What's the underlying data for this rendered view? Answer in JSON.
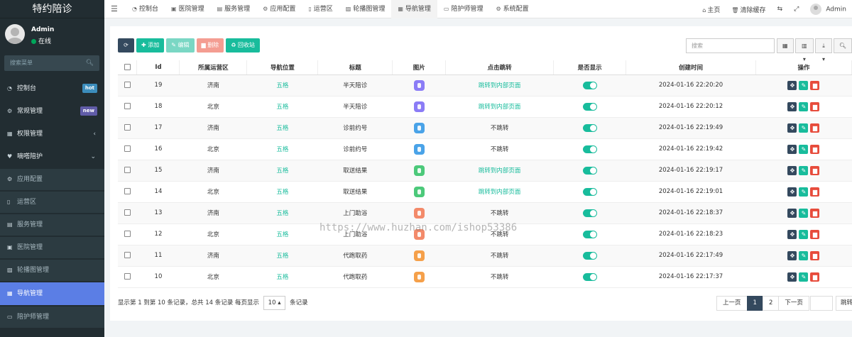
{
  "sidebar": {
    "brand": "特约陪诊",
    "user": {
      "name": "Admin",
      "status": "在线"
    },
    "search_placeholder": "搜索菜单",
    "items": [
      {
        "label": "控制台",
        "badge": "hot"
      },
      {
        "label": "常规管理",
        "badge": "new"
      },
      {
        "label": "权限管理",
        "caret": "‹"
      },
      {
        "label": "嘀嗒陪护",
        "caret": "⌄"
      },
      {
        "label": "应用配置"
      },
      {
        "label": "运营区"
      },
      {
        "label": "服务管理"
      },
      {
        "label": "医院管理"
      },
      {
        "label": "轮播图管理"
      },
      {
        "label": "导航管理"
      },
      {
        "label": "陪护师管理"
      }
    ]
  },
  "topbar": {
    "tabs": [
      "控制台",
      "医院管理",
      "服务管理",
      "应用配置",
      "运营区",
      "轮播图管理",
      "导航管理",
      "陪护师管理",
      "系统配置"
    ],
    "home": "主页",
    "clear_cache": "清除缓存",
    "user": "Admin"
  },
  "toolbar": {
    "add": "添加",
    "edit": "编辑",
    "delete": "删除",
    "recycle": "回收站",
    "search_placeholder": "搜索"
  },
  "table": {
    "headers": [
      "Id",
      "所属运营区",
      "导航位置",
      "标题",
      "图片",
      "点击跳转",
      "是否显示",
      "创建时间",
      "操作"
    ],
    "rows": [
      {
        "id": "19",
        "area": "济南",
        "pos": "五格",
        "title": "半天陪诊",
        "jump": "跳转到内部页面",
        "time": "2024-01-16 22:20:20",
        "color": "#8b7cf6"
      },
      {
        "id": "18",
        "area": "北京",
        "pos": "五格",
        "title": "半天陪诊",
        "jump": "跳转到内部页面",
        "time": "2024-01-16 22:20:12",
        "color": "#8b7cf6"
      },
      {
        "id": "17",
        "area": "济南",
        "pos": "五格",
        "title": "诊前约号",
        "jump": "不跳转",
        "time": "2024-01-16 22:19:49",
        "color": "#4aa3e8"
      },
      {
        "id": "16",
        "area": "北京",
        "pos": "五格",
        "title": "诊前约号",
        "jump": "不跳转",
        "time": "2024-01-16 22:19:42",
        "color": "#4aa3e8"
      },
      {
        "id": "15",
        "area": "济南",
        "pos": "五格",
        "title": "取送结果",
        "jump": "跳转到内部页面",
        "time": "2024-01-16 22:19:17",
        "color": "#4cc97a"
      },
      {
        "id": "14",
        "area": "北京",
        "pos": "五格",
        "title": "取送结果",
        "jump": "跳转到内部页面",
        "time": "2024-01-16 22:19:01",
        "color": "#4cc97a"
      },
      {
        "id": "13",
        "area": "济南",
        "pos": "五格",
        "title": "上门助浴",
        "jump": "不跳转",
        "time": "2024-01-16 22:18:37",
        "color": "#f38a6a"
      },
      {
        "id": "12",
        "area": "北京",
        "pos": "五格",
        "title": "上门助浴",
        "jump": "不跳转",
        "time": "2024-01-16 22:18:23",
        "color": "#f38a6a"
      },
      {
        "id": "11",
        "area": "济南",
        "pos": "五格",
        "title": "代跑取药",
        "jump": "不跳转",
        "time": "2024-01-16 22:17:49",
        "color": "#f5a04a"
      },
      {
        "id": "10",
        "area": "北京",
        "pos": "五格",
        "title": "代跑取药",
        "jump": "不跳转",
        "time": "2024-01-16 22:17:37",
        "color": "#f5a04a"
      }
    ]
  },
  "footer": {
    "info_prefix": "显示第 1 到第 10 条记录，总共 14 条记录 每页显示",
    "page_size": "10",
    "info_suffix": "条记录",
    "prev": "上一页",
    "pages": [
      "1",
      "2"
    ],
    "next": "下一页",
    "jump": "跳转"
  },
  "watermark": "https://www.huzhan.com/ishop53386"
}
